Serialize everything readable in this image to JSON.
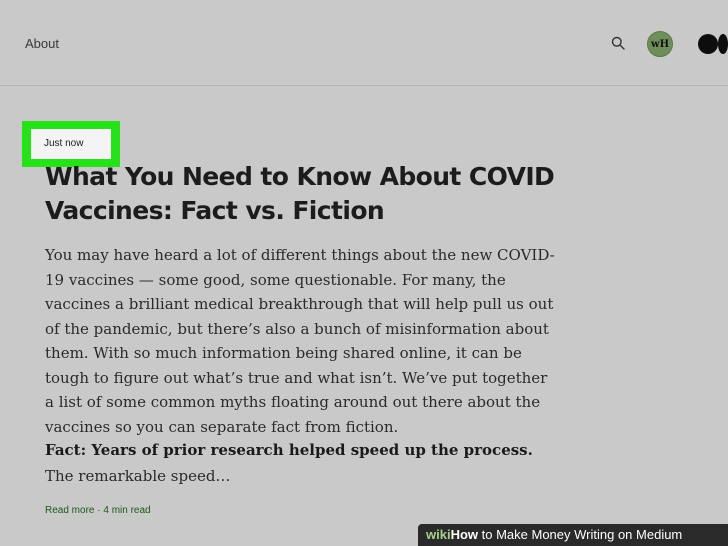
{
  "header": {
    "about_label": "About",
    "avatar_initials": "wH"
  },
  "post": {
    "timestamp": "Just now",
    "title": "What You Need to Know About COVID Vaccines: Fact vs. Fiction",
    "excerpt": "You may have heard a lot of different things about the new COVID-19 vaccines — some good, some questionable. For many, the vaccines a brilliant medical breakthrough that will help pull us out of the pandemic, but there’s also a bunch of misinformation about them. With so much information being shared online, it can be tough to figure out what’s true and what isn’t. We’ve put together a list of some common myths floating around out there about the vaccines so you can separate fact from fiction.",
    "fact_bold": "Fact: Years of prior research helped speed up the process.",
    "fact_rest": " The remarkable speed…",
    "read_more": "Read more · 4 min read"
  },
  "watermark": {
    "wiki": "wiki",
    "how": "How",
    "rest": " to Make Money Writing on Medium"
  },
  "colors": {
    "background": "#c9c9c9",
    "highlight": "#27e21b",
    "read_more": "#1a5a1a",
    "avatar": "#6e8f5c"
  },
  "icons": [
    "search-icon",
    "medium-logo-icon"
  ]
}
